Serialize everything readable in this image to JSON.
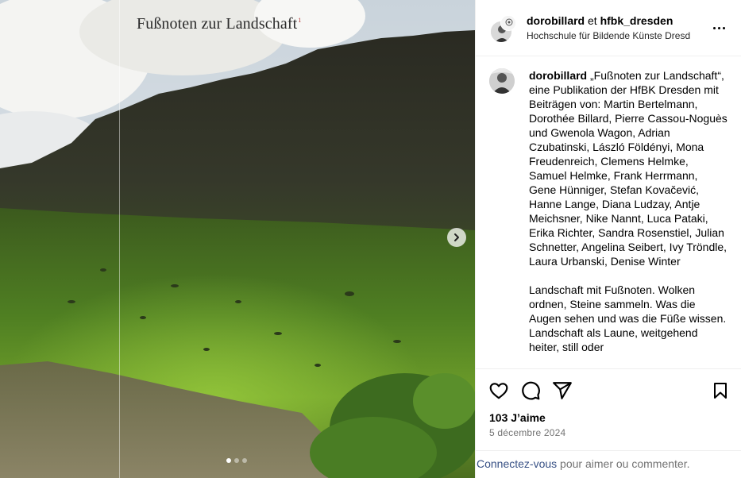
{
  "media": {
    "overlay_title": "Fußnoten zur Landschaft",
    "overlay_mark": "1",
    "next_icon": "chevron-right-icon",
    "carousel": {
      "count": 3,
      "active_index": 0
    }
  },
  "header": {
    "user1": "dorobillard",
    "joiner": "et",
    "user2": "hfbk_dresden",
    "subtitle": "Hochschule für Bildende Künste Dresd",
    "more_icon": "more-horizontal-icon"
  },
  "caption": {
    "username": "dorobillard",
    "paragraph1": "„Fußnoten zur Landschaft“, eine Publikation der HfBK Dresden mit Beiträgen von: Martin Bertelmann, Dorothée Billard, Pierre Cassou-Noguès und Gwenola Wagon, Adrian Czubatinski, László Földényi, Mona Freudenreich, Clemens Helmke, Samuel Helmke, Frank Herrmann, Gene Hünniger, Stefan Kovačević, Hanne Lange, Diana Ludzay, Antje Meichsner, Nike Nannt, Luca Pataki, Erika Richter, Sandra Rosenstiel, Julian Schnetter, Angelina Seibert, Ivy Tröndle, Laura Urbanski, Denise Winter",
    "paragraph2": "Landschaft mit Fußnoten. Wolken ordnen, Steine sammeln. Was die Augen sehen und was die Füße wissen. Landschaft als Laune, weitgehend heiter, still oder"
  },
  "actions": {
    "like_icon": "heart-icon",
    "comment_icon": "comment-icon",
    "share_icon": "share-icon",
    "save_icon": "bookmark-icon"
  },
  "likes": "103 J’aime",
  "date": "5 décembre 2024",
  "footer": {
    "login_link": "Connectez-vous",
    "rest": " pour aimer ou commenter."
  }
}
